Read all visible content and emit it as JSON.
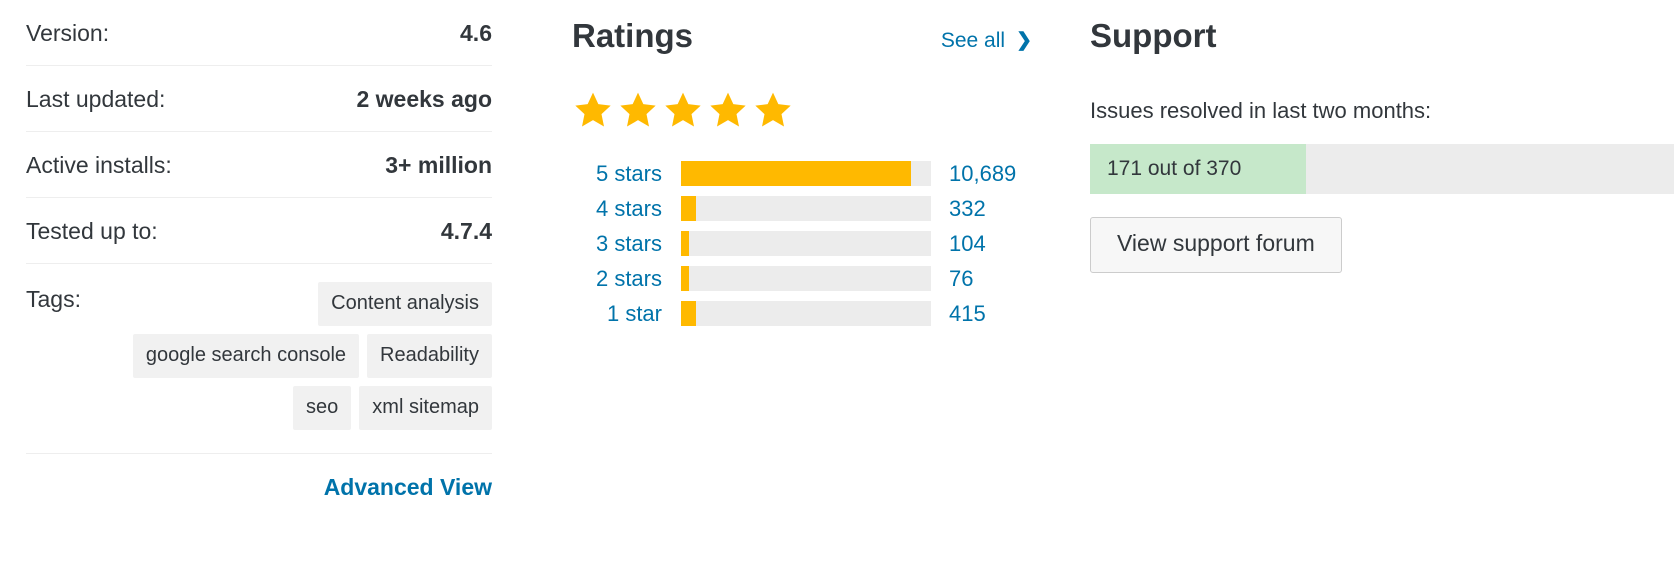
{
  "colors": {
    "link": "#0073aa",
    "text": "#32373c",
    "star": "#ffb900",
    "bar_fill": "#ffb900",
    "bar_track": "#ececec",
    "support_fill": "#c6e8ca",
    "tag_bg": "#f1f1f1"
  },
  "meta": {
    "rows": [
      {
        "label": "Version:",
        "value": "4.6"
      },
      {
        "label": "Last updated:",
        "value": "2 weeks ago"
      },
      {
        "label": "Active installs:",
        "value": "3+ million"
      },
      {
        "label": "Tested up to:",
        "value": "4.7.4"
      }
    ],
    "tags_label": "Tags:",
    "tags": [
      "Content analysis",
      "google search console",
      "Readability",
      "seo",
      "xml sitemap"
    ],
    "advanced_view": "Advanced View"
  },
  "ratings": {
    "title": "Ratings",
    "see_all": "See all",
    "see_all_icon": "chevron-right-icon",
    "stars_filled": 5,
    "star_icon": "star-icon",
    "rows": [
      {
        "label": "5 stars",
        "count": "10,689",
        "value": 10689,
        "percent": 92
      },
      {
        "label": "4 stars",
        "count": "332",
        "value": 332,
        "percent": 6
      },
      {
        "label": "3 stars",
        "count": "104",
        "value": 104,
        "percent": 3
      },
      {
        "label": "2 stars",
        "count": "76",
        "value": 76,
        "percent": 3
      },
      {
        "label": "1 star",
        "count": "415",
        "value": 415,
        "percent": 6
      }
    ]
  },
  "support": {
    "title": "Support",
    "subtitle": "Issues resolved in last two months:",
    "bar_text": "171 out of 370",
    "resolved": 171,
    "total": 370,
    "bar_percent": 37,
    "button_label": "View support forum"
  },
  "chart_data": {
    "type": "bar",
    "title": "Ratings",
    "orientation": "horizontal",
    "categories": [
      "5 stars",
      "4 stars",
      "3 stars",
      "2 stars",
      "1 star"
    ],
    "values": [
      10689,
      332,
      104,
      76,
      415
    ],
    "bar_percents": [
      92,
      6,
      3,
      3,
      6
    ],
    "xlabel": "",
    "ylabel": "",
    "xlim": [
      0,
      11600
    ],
    "grid": false,
    "legend": "none",
    "data_labels": [
      "10,689",
      "332",
      "104",
      "76",
      "415"
    ],
    "colors": {
      "fill": "#ffb900",
      "track": "#ececec"
    }
  }
}
